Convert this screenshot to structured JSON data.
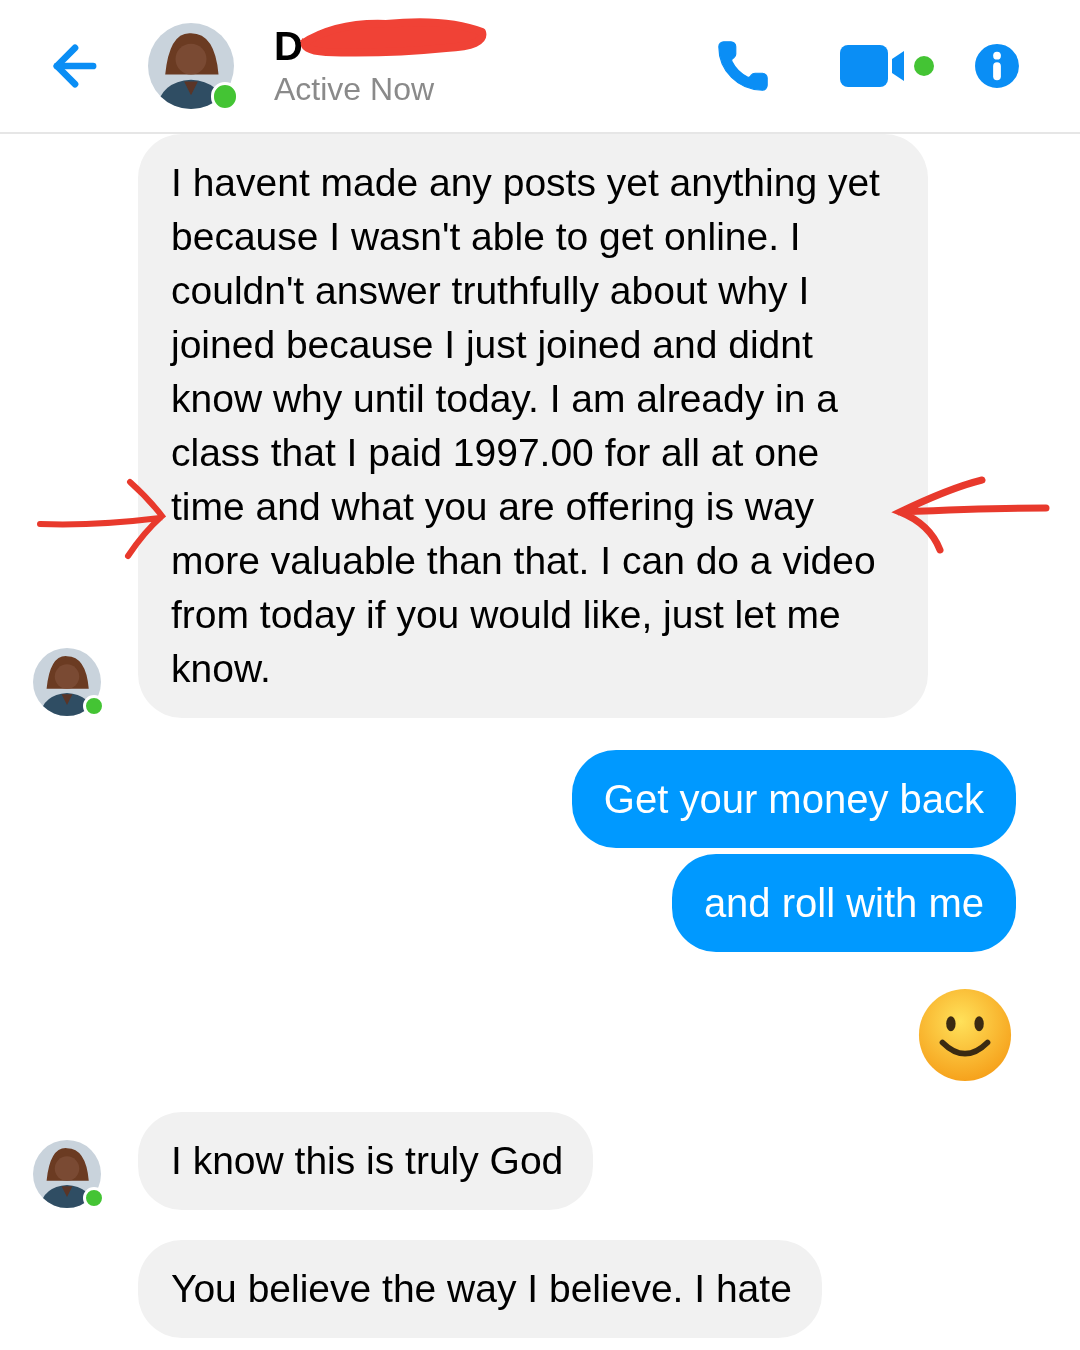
{
  "header": {
    "name": "D",
    "status": "Active Now",
    "online": true
  },
  "messages": [
    {
      "kind": "incoming",
      "text": "I havent made any posts yet anything yet because I wasn't able to get online.  I couldn't answer truthfully about why I joined because I just joined and didnt know why until today. I am already in a class that I paid 1997.00 for all at one time and what you are offering is way more valuable than that. I can do a video from today if you would like, just let me know.",
      "show_avatar": true
    },
    {
      "kind": "outgoing",
      "text": "Get your money back"
    },
    {
      "kind": "outgoing",
      "text": "and roll with me"
    },
    {
      "kind": "emoji"
    },
    {
      "kind": "incoming",
      "text": "I know  this is truly God",
      "show_avatar": true
    },
    {
      "kind": "incoming",
      "text": "You believe the way I believe. I hate",
      "show_avatar": false
    }
  ]
}
